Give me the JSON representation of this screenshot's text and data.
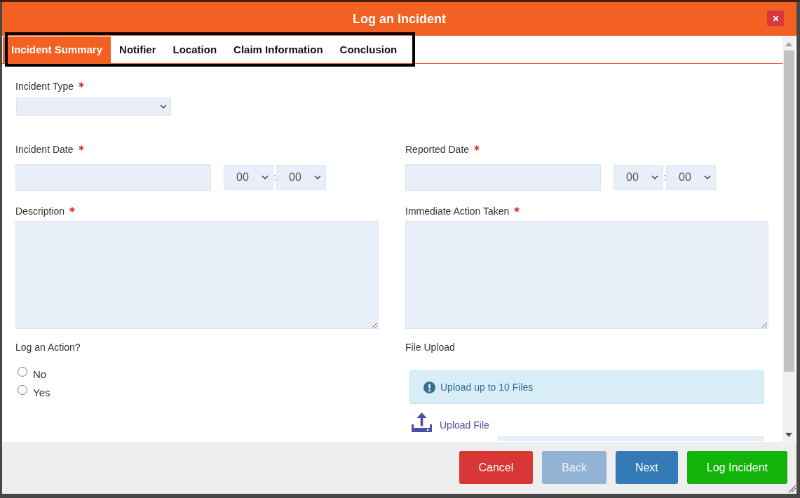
{
  "window": {
    "title": "Log an Incident"
  },
  "tabs": [
    {
      "label": "Incident Summary",
      "selected": true
    },
    {
      "label": "Notifier",
      "selected": false
    },
    {
      "label": "Location",
      "selected": false
    },
    {
      "label": "Claim Information",
      "selected": false
    },
    {
      "label": "Conclusion",
      "selected": false
    }
  ],
  "incident_type": {
    "label": "Incident Type",
    "required": true
  },
  "dates": [
    {
      "label": "Incident Date",
      "required": true,
      "hour": "00",
      "separator": ":",
      "minute": "00"
    },
    {
      "label": "Reported Date",
      "required": true,
      "hour": "00",
      "separator": ":",
      "minute": "00"
    }
  ],
  "text_areas": [
    {
      "label": "Description",
      "required": true
    },
    {
      "label": "Immediate Action Taken",
      "required": true
    }
  ],
  "log_action": {
    "label": "Log an Action?",
    "options": [
      {
        "label": "No",
        "selected": false
      },
      {
        "label": "Yes",
        "selected": false
      }
    ]
  },
  "file_upload": {
    "label": "File Upload",
    "notice": "Upload up to 10 Files",
    "link": "Upload File"
  },
  "buttons": [
    {
      "label": "Cancel",
      "kind": "danger",
      "disabled": false
    },
    {
      "label": "Back",
      "kind": "primary",
      "disabled": true
    },
    {
      "label": "Next",
      "kind": "primary",
      "disabled": false
    },
    {
      "label": "Log Incident",
      "kind": "success",
      "disabled": false
    }
  ]
}
